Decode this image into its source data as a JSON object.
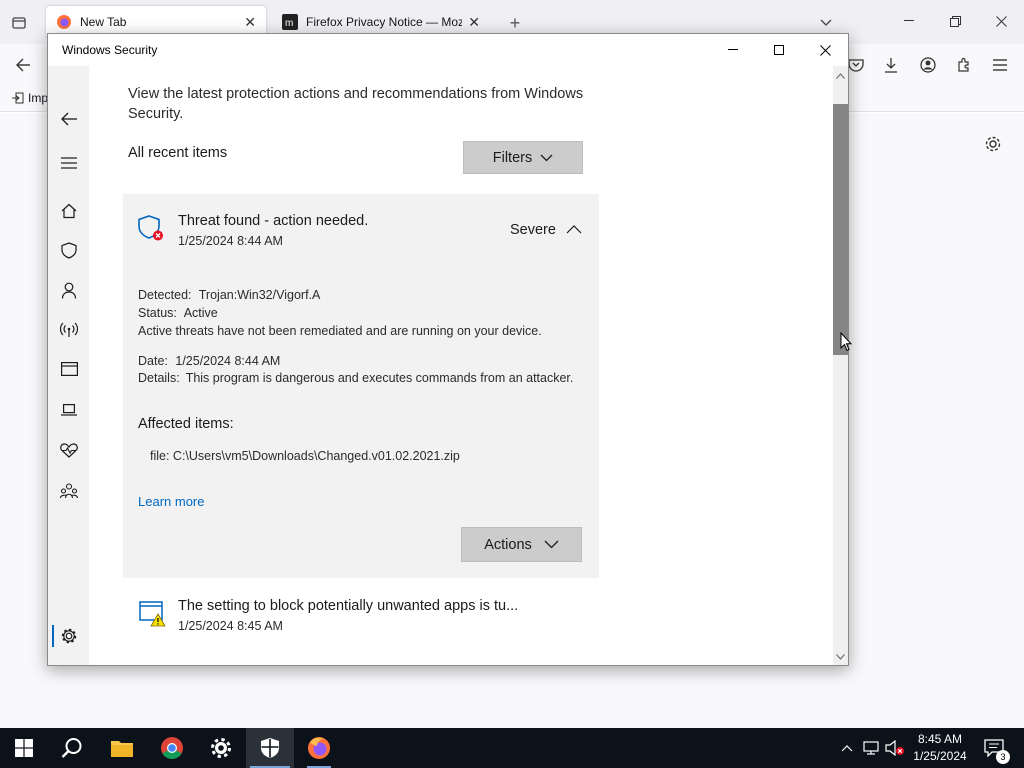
{
  "browser": {
    "tabs": [
      {
        "title": "New Tab"
      },
      {
        "title": "Firefox Privacy Notice — Mozilla"
      }
    ],
    "bookmark_label": "Imp"
  },
  "window": {
    "title": "Windows Security",
    "intro_text": "View the latest protection actions and recommendations from Windows Security.",
    "all_recent_label": "All recent items",
    "filters_label": "Filters"
  },
  "threat": {
    "title": "Threat found - action needed.",
    "date": "1/25/2024 8:44 AM",
    "severity": "Severe",
    "detected_label": "Detected:",
    "detected_value": "Trojan:Win32/Vigorf.A",
    "status_label": "Status:",
    "status_value": "Active",
    "status_note": "Active threats have not been remediated and are running on your device.",
    "date_label": "Date:",
    "date_value": "1/25/2024 8:44 AM",
    "details_label": "Details:",
    "details_value": "This program is dangerous and executes commands from an attacker.",
    "affected_label": "Affected items:",
    "file_line": "file: C:\\Users\\vm5\\Downloads\\Changed.v01.02.2021.zip",
    "learn_more": "Learn more",
    "actions_label": "Actions"
  },
  "second_item": {
    "title": "The setting to block potentially unwanted apps is tu...",
    "date": "1/25/2024 8:45 AM"
  },
  "taskbar": {
    "time": "8:45 AM",
    "date": "1/25/2024",
    "notification_count": "3"
  },
  "colors": {
    "accent": "#0067c0",
    "danger": "#e81123",
    "warning": "#fce100"
  }
}
